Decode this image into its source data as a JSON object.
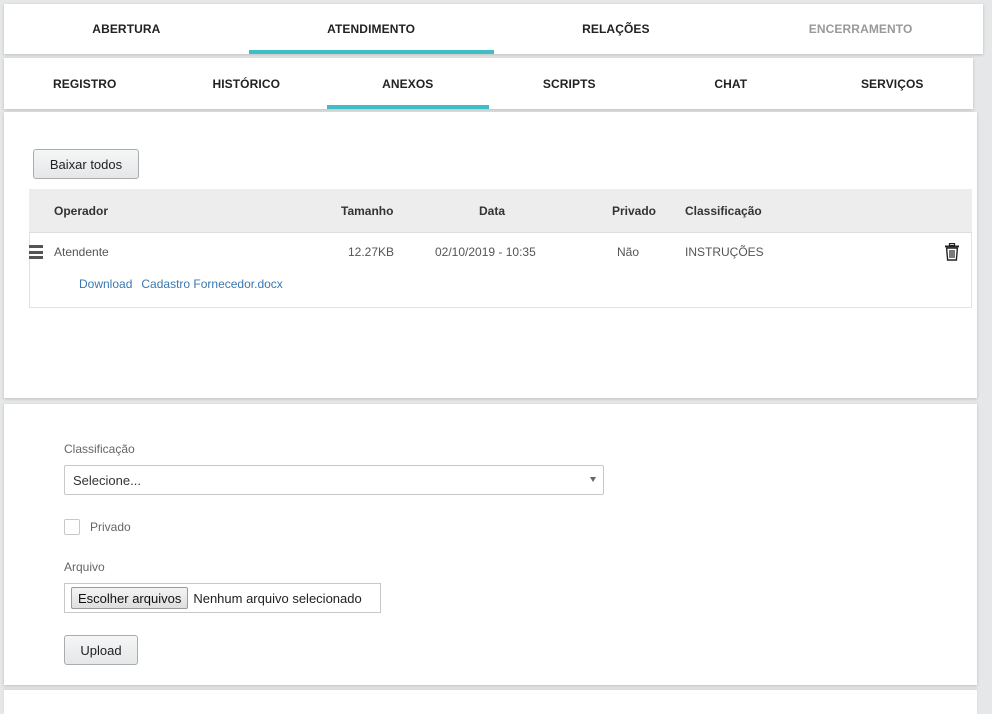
{
  "top_tabs": [
    {
      "label": "ABERTURA",
      "state": "normal"
    },
    {
      "label": "ATENDIMENTO",
      "state": "active"
    },
    {
      "label": "RELAÇÕES",
      "state": "normal"
    },
    {
      "label": "ENCERRAMENTO",
      "state": "disabled"
    }
  ],
  "sub_tabs": [
    {
      "label": "REGISTRO",
      "state": "normal"
    },
    {
      "label": "HISTÓRICO",
      "state": "normal"
    },
    {
      "label": "ANEXOS",
      "state": "active"
    },
    {
      "label": "SCRIPTS",
      "state": "normal"
    },
    {
      "label": "CHAT",
      "state": "normal"
    },
    {
      "label": "SERVIÇOS",
      "state": "normal"
    }
  ],
  "attachments": {
    "download_all_label": "Baixar todos",
    "columns": {
      "operator": "Operador",
      "size": "Tamanho",
      "date": "Data",
      "private": "Privado",
      "classification": "Classificação"
    },
    "rows": [
      {
        "operator": "Atendente",
        "size": "12.27KB",
        "date": "02/10/2019 - 10:35",
        "private": "Não",
        "classification": "INSTRUÇÕES",
        "download_label": "Download",
        "file_name": "Cadastro Fornecedor.docx",
        "icons": {
          "drag": "hamburger-icon",
          "delete": "trash-icon"
        }
      }
    ]
  },
  "upload_form": {
    "classification_label": "Classificação",
    "classification_value": "Selecione...",
    "private_label": "Privado",
    "private_checked": false,
    "file_label": "Arquivo",
    "choose_files_label": "Escolher arquivos",
    "file_status": "Nenhum arquivo selecionado",
    "upload_label": "Upload"
  },
  "colors": {
    "accent": "#3fbfc5",
    "link": "#3b78b0",
    "background": "#e5e7e8"
  }
}
